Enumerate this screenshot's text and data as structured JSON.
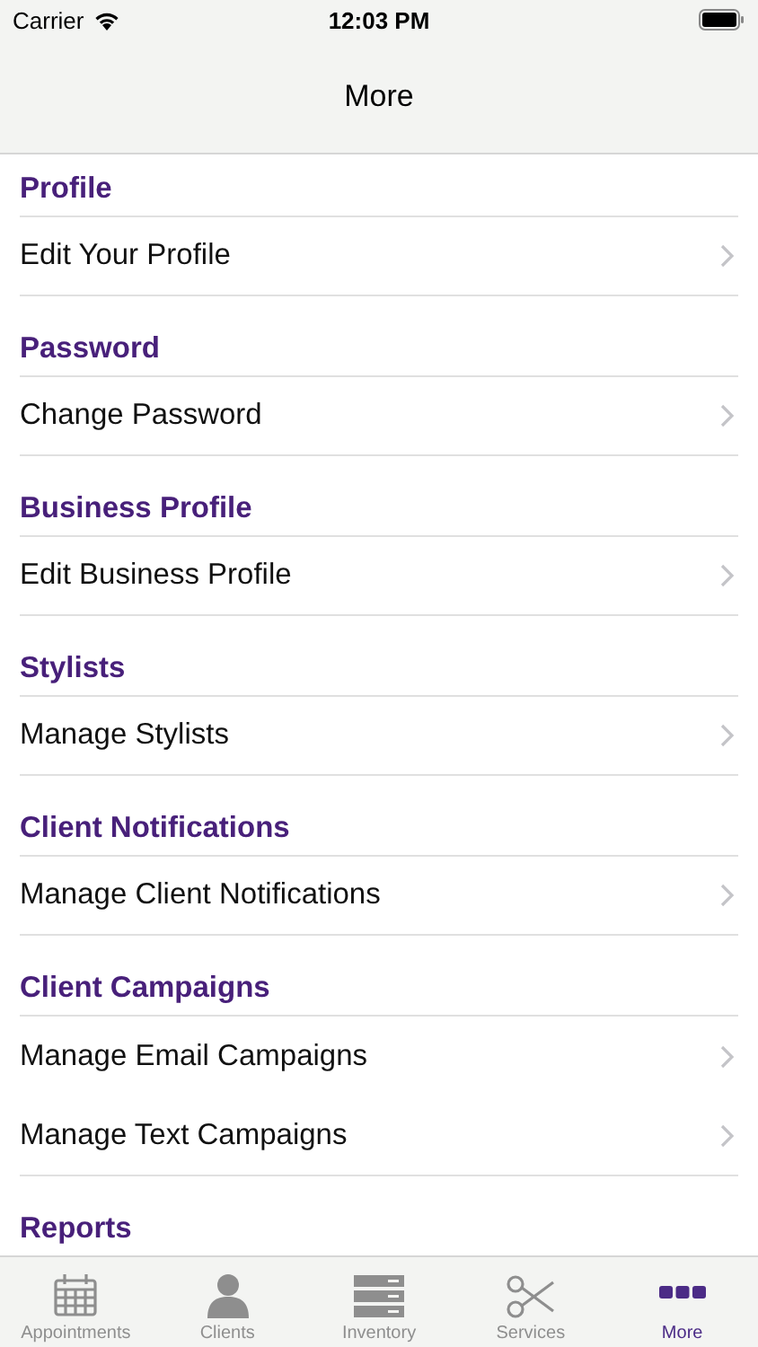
{
  "status_bar": {
    "carrier": "Carrier",
    "time": "12:03 PM"
  },
  "nav_bar": {
    "title": "More"
  },
  "sections": [
    {
      "title": "Profile",
      "items": [
        "Edit Your Profile"
      ]
    },
    {
      "title": "Password",
      "items": [
        "Change Password"
      ]
    },
    {
      "title": "Business Profile",
      "items": [
        "Edit Business Profile"
      ]
    },
    {
      "title": "Stylists",
      "items": [
        "Manage Stylists"
      ]
    },
    {
      "title": "Client Notifications",
      "items": [
        "Manage Client Notifications"
      ]
    },
    {
      "title": "Client Campaigns",
      "items": [
        "Manage Email Campaigns",
        "Manage Text Campaigns"
      ]
    },
    {
      "title": "Reports"
    }
  ],
  "tab_bar": [
    {
      "label": "Appointments",
      "kind": "calendar",
      "selected": false
    },
    {
      "label": "Clients",
      "kind": "person",
      "selected": false
    },
    {
      "label": "Inventory",
      "kind": "stack",
      "selected": false
    },
    {
      "label": "Services",
      "kind": "scissors",
      "selected": false
    },
    {
      "label": "More",
      "kind": "dots",
      "selected": true
    }
  ]
}
